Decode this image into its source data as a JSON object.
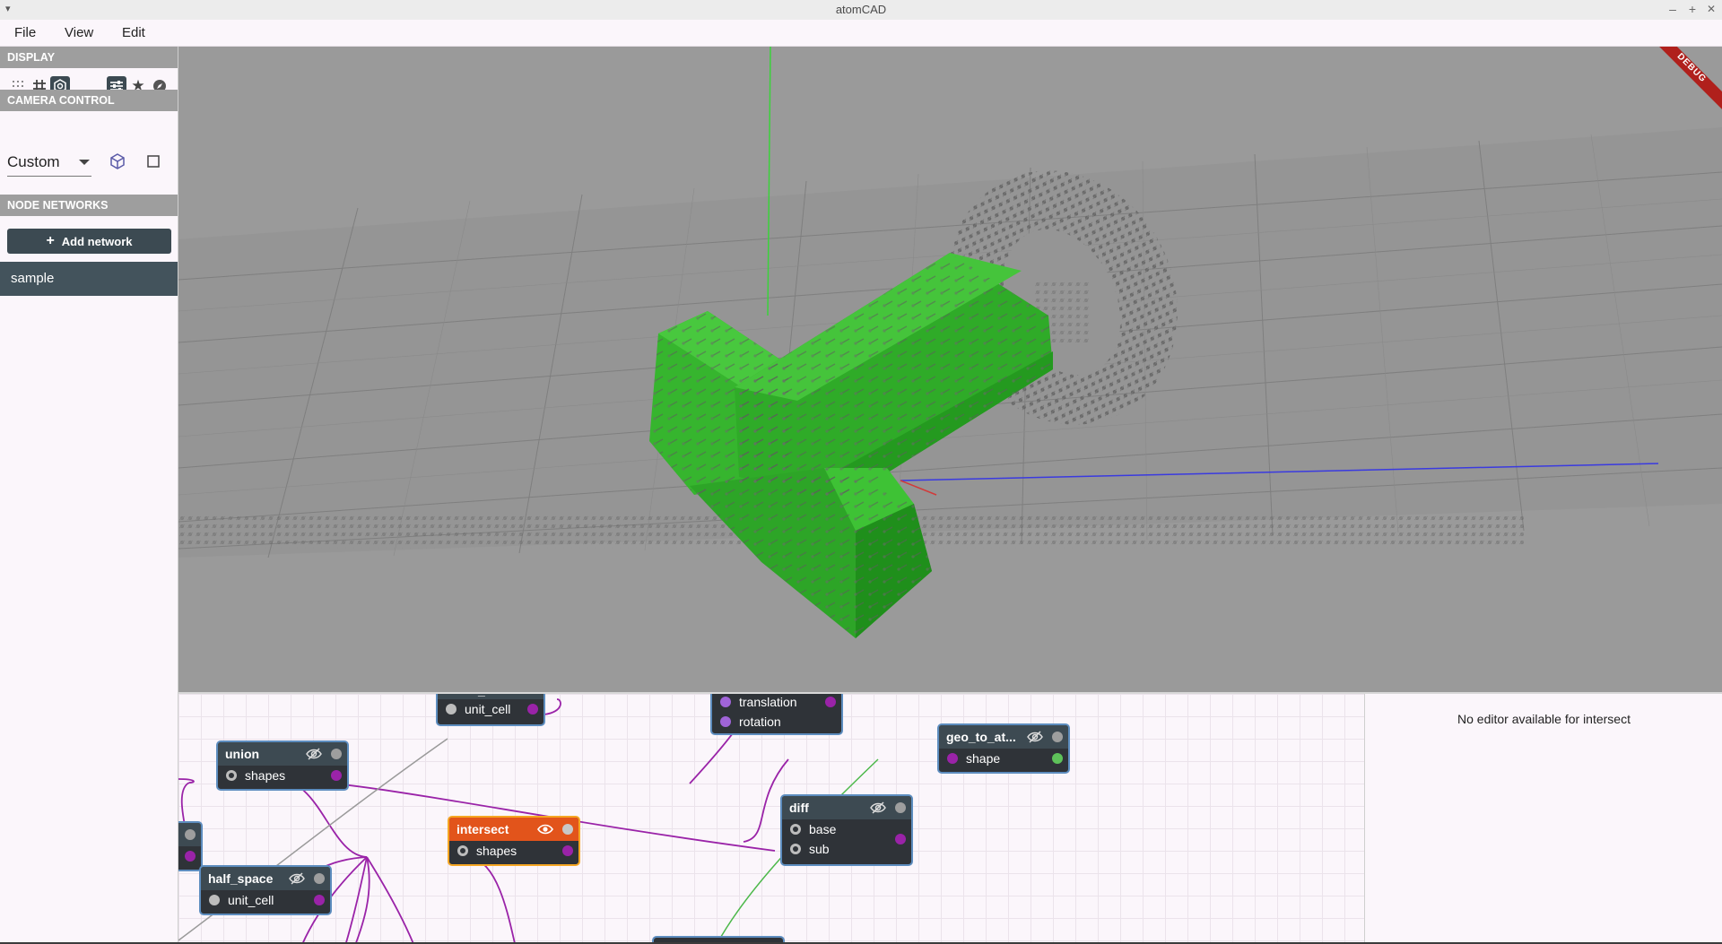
{
  "window": {
    "title": "atomCAD",
    "minimize": "–",
    "maximize": "+",
    "close": "✕",
    "menu_corner": "▾"
  },
  "menu": {
    "items": [
      "File",
      "View",
      "Edit"
    ]
  },
  "sidebar": {
    "display_header": "DISPLAY",
    "camera_header": "CAMERA CONTROL",
    "camera_mode": "Custom",
    "networks_header": "NODE NETWORKS",
    "add_network_label": "Add network",
    "add_icon": "+",
    "networks": [
      "sample"
    ]
  },
  "viewport": {
    "debug_banner": "DEBUG"
  },
  "node_editor": {
    "nodes": {
      "top_a": {
        "title": "_",
        "inputs": [
          "unit_cell"
        ]
      },
      "top_b": {
        "inputs": [
          "translation",
          "rotation"
        ]
      },
      "union": {
        "title": "union",
        "inputs": [
          "shapes"
        ]
      },
      "intersect": {
        "title": "intersect",
        "inputs": [
          "shapes"
        ]
      },
      "diff": {
        "title": "diff",
        "inputs": [
          "base",
          "sub"
        ]
      },
      "geo_to_at": {
        "title": "geo_to_at...",
        "inputs": [
          "shape"
        ]
      },
      "half_space": {
        "title": "half_space",
        "inputs": [
          "unit_cell"
        ]
      }
    }
  },
  "properties": {
    "message": "No editor available for intersect"
  },
  "colors": {
    "accent_dark": "#3c4a52",
    "selected_node": "#e2541b",
    "wire": "#9a23a8",
    "viewport_bg": "#9a9a9a",
    "geometry": "#2fb52a"
  }
}
